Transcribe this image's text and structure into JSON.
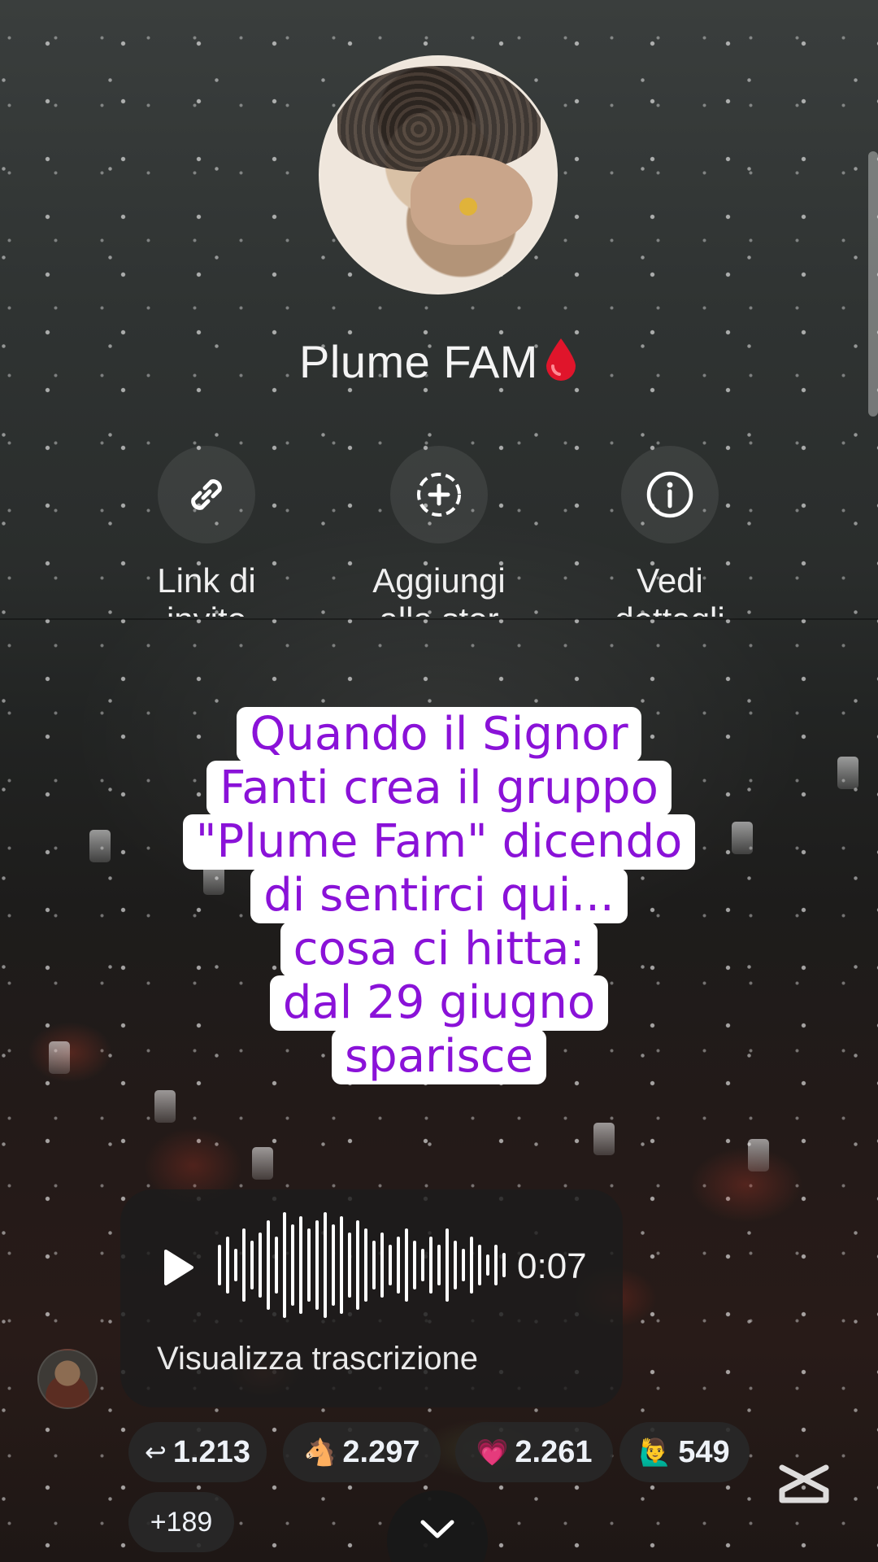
{
  "group": {
    "name": "Plume FAM",
    "name_emoji": "blood-drop-icon"
  },
  "actions": [
    {
      "icon": "link-icon",
      "label_line1": "Link di",
      "label_line2": "invito"
    },
    {
      "icon": "add-circle-icon",
      "label_line1": "Aggiungi",
      "label_line2": "alla stor"
    },
    {
      "icon": "info-icon",
      "label_line1": "Vedi",
      "label_line2": "dettagli"
    }
  ],
  "caption": {
    "lines": [
      "Quando il Signor",
      "Fanti crea il gruppo",
      "\"Plume Fam\" dicendo",
      "di sentirci qui...",
      "cosa ci hitta:",
      "dal 29 giugno",
      "sparisce"
    ],
    "text_color": "#8a12d8"
  },
  "voice_message": {
    "duration": "0:07",
    "transcript_link": "Visualizza trascrizione"
  },
  "reactions": [
    {
      "emoji": "↩",
      "icon": "reply-icon",
      "count": "1.213"
    },
    {
      "emoji": "🐴",
      "icon": "horse-emoji-icon",
      "count": "2.297"
    },
    {
      "emoji": "💗",
      "icon": "heart-emoji-icon",
      "count": "2.261"
    },
    {
      "emoji": "🙋‍♂️",
      "icon": "raising-hand-emoji-icon",
      "count": "549"
    }
  ],
  "more_reactions": "+189"
}
